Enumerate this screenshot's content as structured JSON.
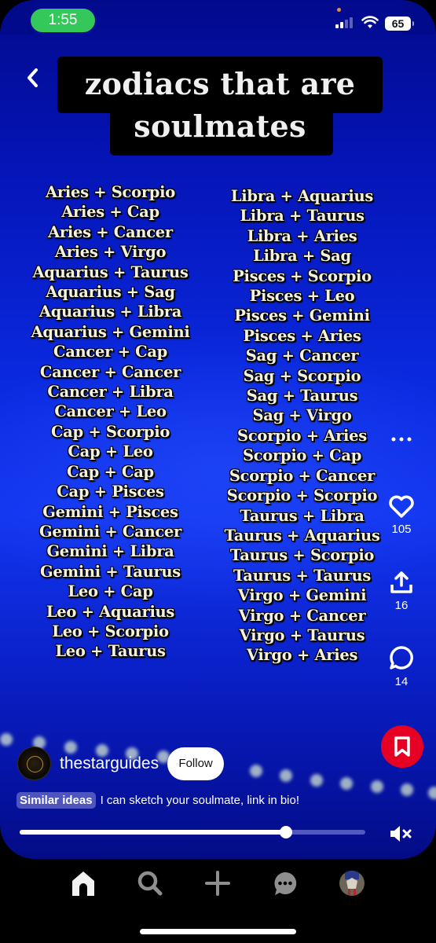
{
  "status_bar": {
    "time": "1:55",
    "battery": "65",
    "icons": [
      "cellular-signal-icon",
      "wifi-icon",
      "battery-icon"
    ]
  },
  "nav": {
    "back_icon": "chevron-left-icon"
  },
  "pin": {
    "title": "zodiacs that are soulmates",
    "left_column": [
      "Aries + Scorpio",
      "Aries + Cap",
      "Aries + Cancer",
      "Aries + Virgo",
      "Aquarius + Taurus",
      "Aquarius + Sag",
      "Aquarius + Libra",
      "Aquarius + Gemini",
      "Cancer + Cap",
      "Cancer + Cancer",
      "Cancer + Libra",
      "Cancer + Leo",
      "Cap + Scorpio",
      "Cap + Leo",
      "Cap + Cap",
      "Cap + Pisces",
      "Gemini + Pisces",
      "Gemini + Cancer",
      "Gemini + Libra",
      "Gemini + Taurus",
      "Leo + Cap",
      "Leo + Aquarius",
      "Leo + Scorpio",
      "Leo + Taurus"
    ],
    "right_column": [
      "Libra + Aquarius",
      "Libra + Taurus",
      "Libra + Aries",
      "Libra + Sag",
      "Pisces + Scorpio",
      "Pisces + Leo",
      "Pisces + Gemini",
      "Pisces + Aries",
      "Sag + Cancer",
      "Sag + Scorpio",
      "Sag + Taurus",
      "Sag + Virgo",
      "Scorpio + Aries",
      "Scorpio + Cap",
      "Scorpio + Cancer",
      "Scorpio + Scorpio",
      "Taurus + Libra",
      "Taurus + Aquarius",
      "Taurus + Scorpio",
      "Taurus + Taurus",
      "Virgo + Gemini",
      "Virgo + Cancer",
      "Virgo + Taurus",
      "Virgo + Aries"
    ]
  },
  "actions": {
    "more_icon": "more-horizontal-icon",
    "likes": "105",
    "shares": "16",
    "comments": "14"
  },
  "creator": {
    "username": "thestarguides",
    "follow_label": "Follow"
  },
  "caption": {
    "chip_label": "Similar ideas",
    "text": "I can sketch your soulmate, link in bio!"
  },
  "playback": {
    "progress": 0.77,
    "muted": true
  },
  "colors": {
    "save_red": "#e60023",
    "time_pill_green": "#34c759"
  },
  "tab_bar": {
    "tabs": [
      "home",
      "search",
      "create",
      "messages",
      "profile"
    ],
    "active": "home"
  }
}
